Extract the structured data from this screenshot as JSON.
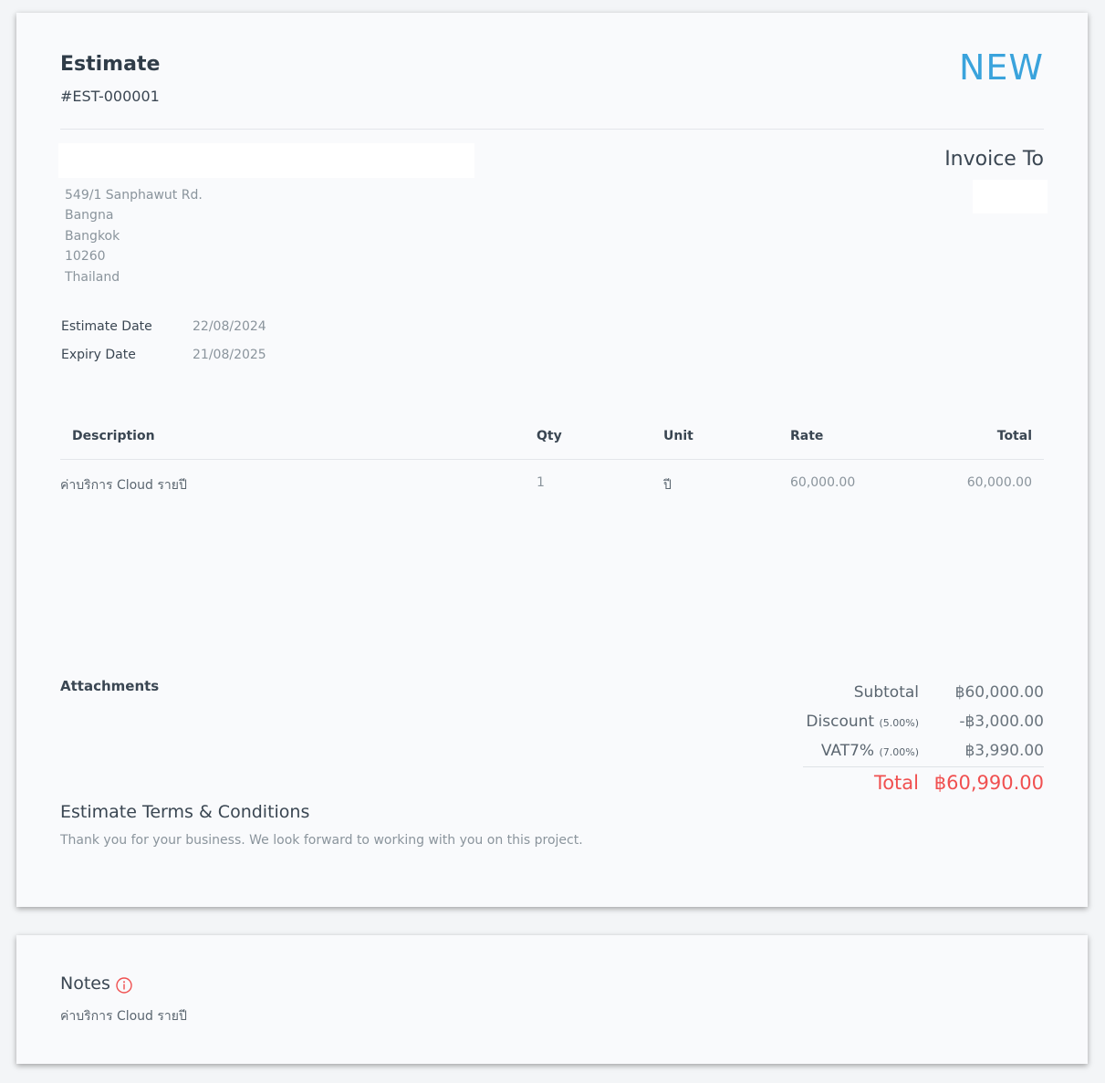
{
  "estimate": {
    "title": "Estimate",
    "number": "#EST-000001",
    "status": "NEW"
  },
  "company": {
    "address_lines": [
      "549/1 Sanphawut Rd.",
      "Bangna",
      "Bangkok",
      "10260",
      "Thailand"
    ]
  },
  "invoice_to": {
    "label": "Invoice To"
  },
  "meta": {
    "estimate_date_label": "Estimate Date",
    "estimate_date": "22/08/2024",
    "expiry_date_label": "Expiry Date",
    "expiry_date": "21/08/2025"
  },
  "table": {
    "headers": {
      "description": "Description",
      "qty": "Qty",
      "unit": "Unit",
      "rate": "Rate",
      "total": "Total"
    },
    "rows": [
      {
        "description": "ค่าบริการ Cloud รายปี",
        "qty": "1",
        "unit": "ปี",
        "rate": "60,000.00",
        "total": "60,000.00"
      }
    ]
  },
  "attachments": {
    "label": "Attachments"
  },
  "summary": {
    "subtotal_label": "Subtotal",
    "subtotal": "฿60,000.00",
    "discount_label": "Discount",
    "discount_pct": "(5.00%)",
    "discount": "-฿3,000.00",
    "vat_label": "VAT7%",
    "vat_pct": "(7.00%)",
    "vat": "฿3,990.00",
    "total_label": "Total",
    "total": "฿60,990.00"
  },
  "terms": {
    "title": "Estimate Terms & Conditions",
    "text": "Thank you for your business. We look forward to working with you on this project."
  },
  "notes": {
    "title": "Notes",
    "icon": "info-icon",
    "text": "ค่าบริการ Cloud รายปี"
  },
  "colors": {
    "status": "#3aa3dc",
    "total": "#f05050",
    "info_icon": "#f05050"
  }
}
